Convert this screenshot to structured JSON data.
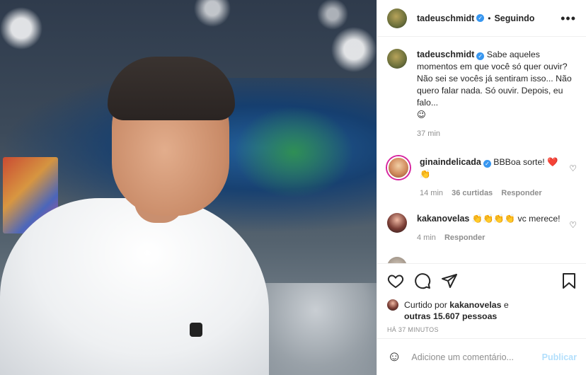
{
  "header": {
    "username": "tadeuschmidt",
    "separator": "•",
    "follow_status": "Seguindo",
    "more": "•••"
  },
  "caption": {
    "username": "tadeuschmidt",
    "text": "Sabe aqueles momentos em que você só quer ouvir? Não sei se vocês já sentiram isso... Não quero falar nada. Só ouvir. Depois, eu falo...",
    "emoji": "😉",
    "time": "37 min"
  },
  "comments": [
    {
      "username": "ginaindelicada",
      "text": "BBBoa sorte! ❤️",
      "line2": "👏",
      "time": "14 min",
      "likes": "36 curtidas",
      "reply": "Responder"
    },
    {
      "username": "kakanovelas",
      "text": "👏👏👏👏 vc merece!",
      "time": "4 min",
      "reply": "Responder"
    }
  ],
  "likes": {
    "prefix": "Curtido por",
    "user": "kakanovelas",
    "conj": "e",
    "others": "outras 15.607 pessoas"
  },
  "posted_ago": "HÁ 37 MINUTOS",
  "comment_box": {
    "placeholder": "Adicione um comentário...",
    "post_label": "Publicar"
  }
}
